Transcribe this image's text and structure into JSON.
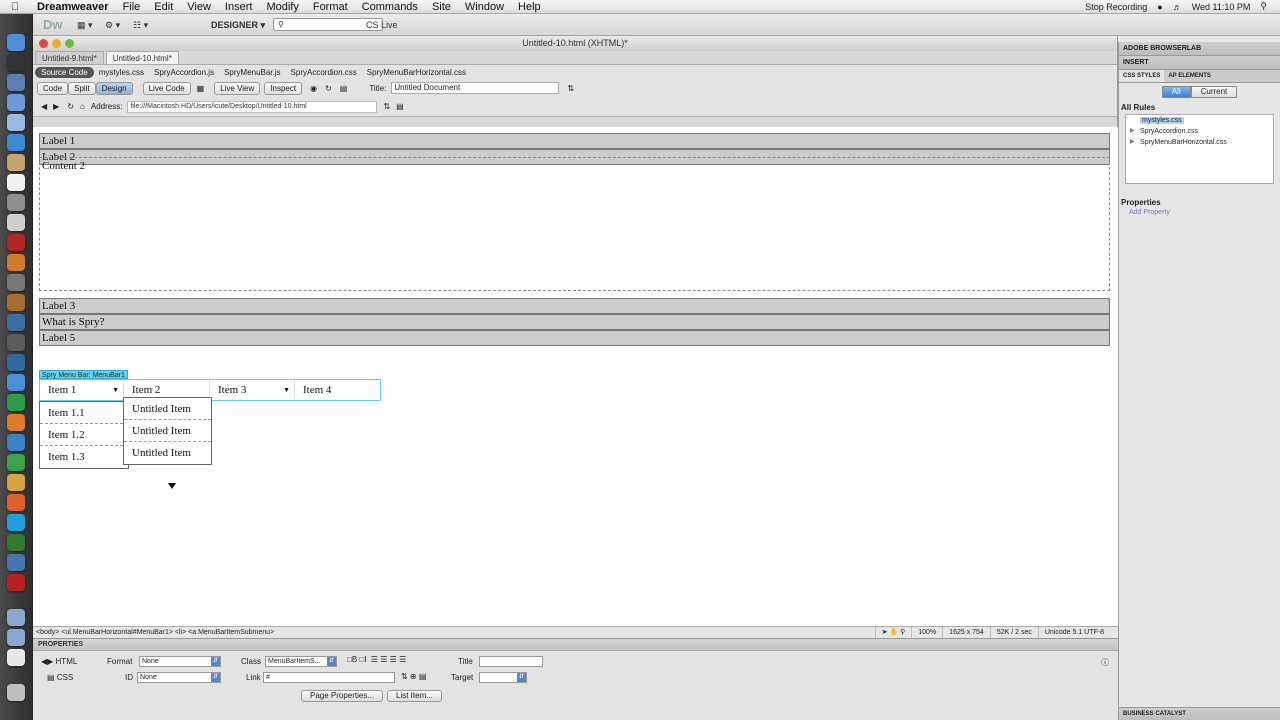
{
  "menubar": {
    "app": "Dreamweaver",
    "items": [
      "File",
      "Edit",
      "View",
      "Insert",
      "Modify",
      "Format",
      "Commands",
      "Site",
      "Window",
      "Help"
    ],
    "stop_recording": "Stop Recording",
    "clock": "Wed 11:10 PM"
  },
  "toolbar": {
    "logo": "Dw",
    "workspace": "DESIGNER ▾",
    "cslive": "CS Live"
  },
  "document": {
    "window_title": "Untitled-10.html (XHTML)*",
    "tabs": [
      "Untitled-9.html*",
      "Untitled-10.html*"
    ],
    "related_files": [
      "Source Code",
      "mystyles.css",
      "SpryAccordion.js",
      "SpryMenuBar.js",
      "SpryAccordion.css",
      "SpryMenuBarHorizontal.css"
    ],
    "view_buttons": [
      "Code",
      "Split",
      "Design"
    ],
    "live_code": "Live Code",
    "live_view": "Live View",
    "inspect": "Inspect",
    "title_label": "Title:",
    "title_value": "Untitled Document",
    "address_label": "Address:",
    "address_value": "file:///Macintosh HD/Users/icute/Desktop/Untitled-10.html"
  },
  "accordion": {
    "labels_top": [
      "Label 1",
      "Label 2"
    ],
    "content": "Content 2",
    "labels_bottom": [
      "Label 3",
      "What is Spry?",
      "Label 5"
    ]
  },
  "spry_menu": {
    "tag": "Spry Menu Bar: MenuBar1",
    "items": [
      "Item 1",
      "Item 2",
      "Item 3",
      "Item 4"
    ],
    "sub1": [
      "Item 1.1",
      "Item 1.2",
      "Item 1.3"
    ],
    "sub2": [
      "Untitled Item",
      "Untitled Item",
      "Untitled Item"
    ]
  },
  "statusbar": {
    "tag_path": "<body> <ul.MenuBarHorizontal#MenuBar1> <li> <a.MenuBarItemSubmenu>",
    "zoom": "100%",
    "size": "1625 x 754",
    "download": "52K / 2 sec",
    "encoding": "Unicode 5.1 UTF-8"
  },
  "properties": {
    "header": "PROPERTIES",
    "html_btn": "HTML",
    "css_btn": "CSS",
    "format_label": "Format",
    "format_value": "None",
    "class_label": "Class",
    "class_value": "MenuBarItemS...",
    "id_label": "ID",
    "id_value": "None",
    "link_label": "Link",
    "link_value": "#",
    "title_label": "Title",
    "target_label": "Target",
    "page_props": "Page Properties...",
    "list_item": "List Item..."
  },
  "right_panel": {
    "browserlab": "ADOBE BROWSERLAB",
    "insert": "INSERT",
    "css_styles": "CSS STYLES",
    "ap_elements": "AP ELEMENTS",
    "all": "All",
    "current": "Current",
    "all_rules": "All Rules",
    "rules": [
      "mystyles.css",
      "SpryAccordion.css",
      "SpryMenuBarHorizontal.css"
    ],
    "properties": "Properties",
    "add_property": "Add Property",
    "business_catalyst": "BUSINESS CATALYST"
  },
  "colors": {
    "menu_highlight": "#63d5f2",
    "accordion_tab": "#cccccc",
    "selected_seg": "#3f7fd8"
  }
}
